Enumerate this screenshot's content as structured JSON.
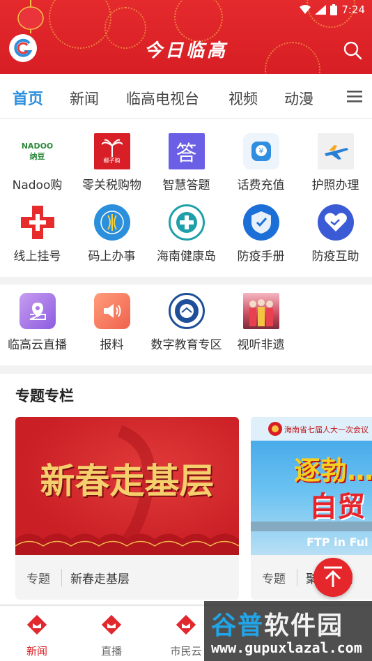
{
  "status_bar": {
    "time": "7:24"
  },
  "header": {
    "title": "今日临高",
    "logo_icon": "app-logo-icon",
    "search_icon": "search-icon",
    "accent": "#d71e24"
  },
  "tabs": {
    "items": [
      {
        "label": "首页",
        "active": true
      },
      {
        "label": "新闻"
      },
      {
        "label": "临高电视台"
      },
      {
        "label": "视频"
      },
      {
        "label": "动漫"
      }
    ],
    "menu_icon": "hamburger-menu-icon",
    "active_color": "#2e8fdc"
  },
  "services": [
    {
      "label": "Nadoo购",
      "icon": "nadoo-logo-icon",
      "logo_text": "NADOO纳豆"
    },
    {
      "label": "零关税购物",
      "icon": "palm-tree-icon",
      "logo_text": "椰子购"
    },
    {
      "label": "智慧答题",
      "icon": "answer-icon",
      "logo_text": "答"
    },
    {
      "label": "话费充值",
      "icon": "phone-yen-icon"
    },
    {
      "label": "护照办理",
      "icon": "airplane-icon"
    },
    {
      "label": "线上挂号",
      "icon": "red-cross-icon"
    },
    {
      "label": "码上办事",
      "icon": "qr-service-icon"
    },
    {
      "label": "海南健康岛",
      "icon": "health-island-icon"
    },
    {
      "label": "防疫手册",
      "icon": "shield-icon"
    },
    {
      "label": "防疫互助",
      "icon": "heart-handshake-icon"
    }
  ],
  "services2": [
    {
      "label": "临高云直播",
      "icon": "map-pin-icon"
    },
    {
      "label": "报料",
      "icon": "speaker-icon"
    },
    {
      "label": "数字教育专区",
      "icon": "education-emblem-icon"
    },
    {
      "label": "视听非遗",
      "icon": "heritage-photo-icon"
    }
  ],
  "topics": {
    "title": "专题专栏",
    "cards": [
      {
        "tag": "专题",
        "name": "新春走基层",
        "banner_text": "新春走基层"
      },
      {
        "tag": "专题",
        "name": "聚…南两",
        "banner_header": "海南省七届人大一次会议",
        "banner_text": "逐勃…",
        "banner_sub": "自贸",
        "banner_ftp": "FTP in Ful"
      }
    ]
  },
  "up_button_icon": "arrow-up-icon",
  "bottom_nav": [
    {
      "label": "新闻",
      "active": true
    },
    {
      "label": "直播"
    },
    {
      "label": "市民云"
    }
  ],
  "watermark": {
    "line1a": "谷普",
    "line1b": "软件园",
    "line2": "www.gupuxlazal.com"
  }
}
